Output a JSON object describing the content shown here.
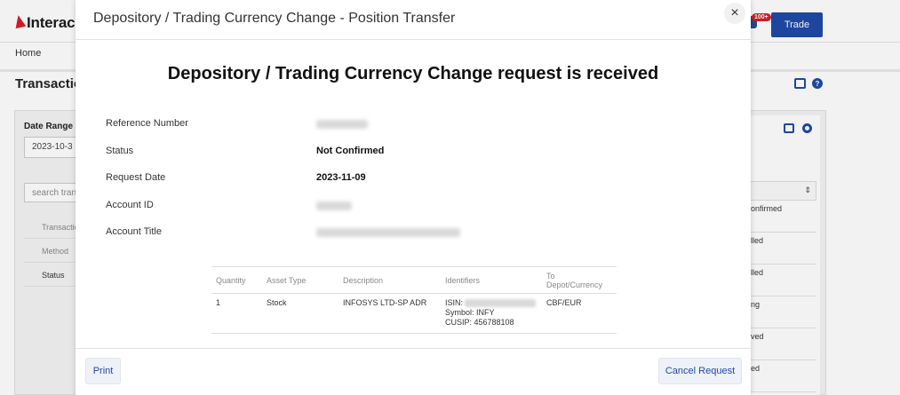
{
  "background": {
    "logo_text": "Interac",
    "notification_badge": "100+",
    "trade_button": "Trade",
    "home_link": "Home",
    "page_heading": "Transactio",
    "help_icon_label": "?",
    "date_range_label": "Date Range",
    "date_value": "2023-10-3",
    "search_placeholder": "search tran",
    "filters": [
      "Transactio",
      "Method",
      "Status"
    ],
    "right_statuses": [
      "onfirmed",
      "lled",
      "lled",
      "ng",
      "ved",
      "ed"
    ],
    "sort_icon": "sort-icon"
  },
  "modal": {
    "title": "Depository / Trading Currency Change - Position Transfer",
    "close_label": "×",
    "heading": "Depository / Trading Currency Change request is received",
    "fields": [
      {
        "label": "Reference Number",
        "value": ""
      },
      {
        "label": "Status",
        "value": "Not Confirmed"
      },
      {
        "label": "Request Date",
        "value": "2023-11-09"
      },
      {
        "label": "Account ID",
        "value": ""
      },
      {
        "label": "Account Title",
        "value": ""
      }
    ],
    "table": {
      "headers": [
        "Quantity",
        "Asset Type",
        "Description",
        "Identifiers",
        "To Depot/Currency"
      ],
      "row": {
        "quantity": "1",
        "asset_type": "Stock",
        "description": "INFOSYS LTD-SP ADR",
        "isin_label": "ISIN:",
        "symbol": "Symbol: INFY",
        "cusip": "CUSIP: 456788108",
        "to_depot": "CBF/EUR"
      }
    },
    "print_button": "Print",
    "cancel_button": "Cancel Request"
  },
  "colors": {
    "accent": "#1f4aa8",
    "brand_red": "#d81e2a"
  }
}
